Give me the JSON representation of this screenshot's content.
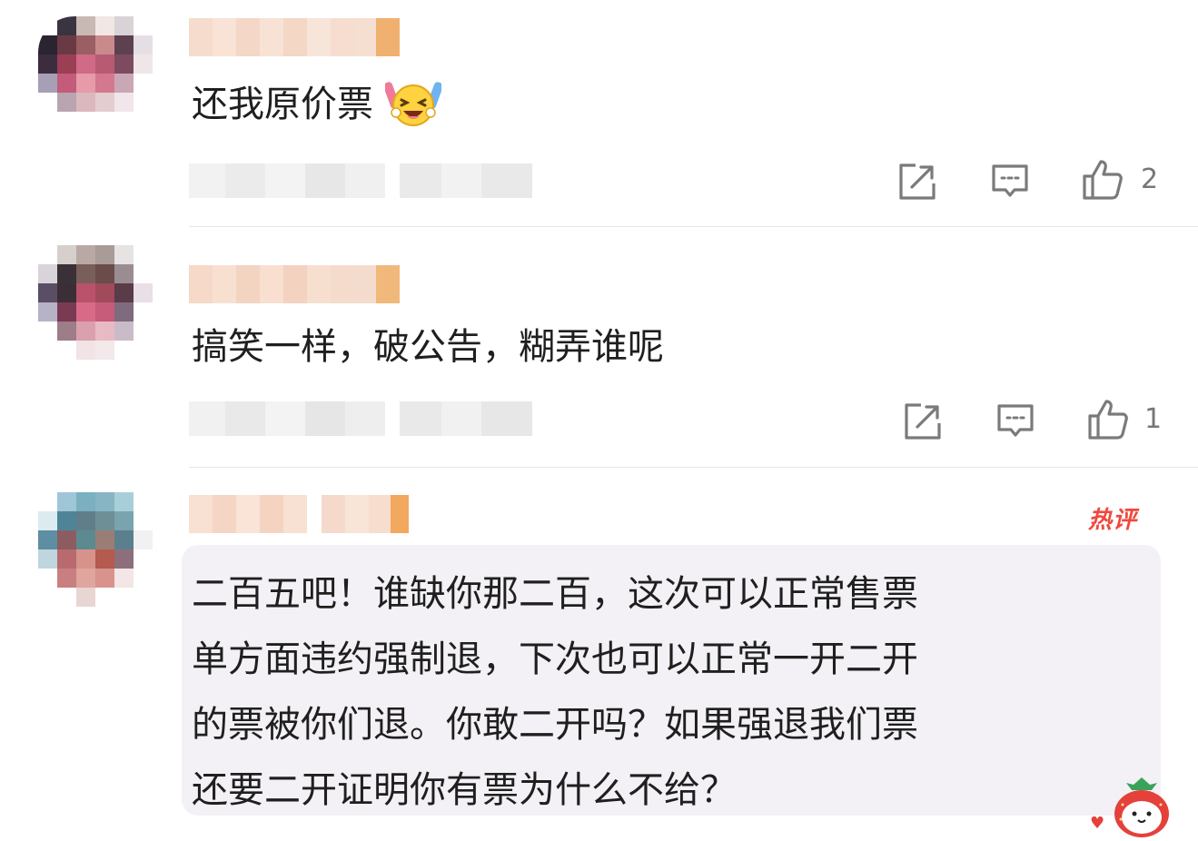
{
  "comments": [
    {
      "text": "还我原价票",
      "emoji": "laughing-with-glowsticks-emoji",
      "like_count": "2",
      "hot": false
    },
    {
      "text": "搞笑一样，破公告，糊弄谁呢",
      "like_count": "1",
      "hot": false
    },
    {
      "text_lines": [
        "二百五吧！谁缺你那二百，这次可以正常售票",
        "单方面违约强制退，下次也可以正常一开二开",
        "的票被你们退。你敢二开吗？如果强退我们票",
        "还要二开证明你有票为什么不给？"
      ],
      "hot": true,
      "hot_label": "热评"
    }
  ],
  "icons": {
    "share": "share-icon",
    "reply": "comment-bubble-icon",
    "like": "thumbs-up-icon",
    "mascot": "strawberry-mascot-icon"
  },
  "colors": {
    "text": "#1f1f1f",
    "icon": "#7a7a7a",
    "hot_red": "#f0483e",
    "bubble_bg": "#f3f1f5",
    "divider": "#e6e6e6"
  }
}
